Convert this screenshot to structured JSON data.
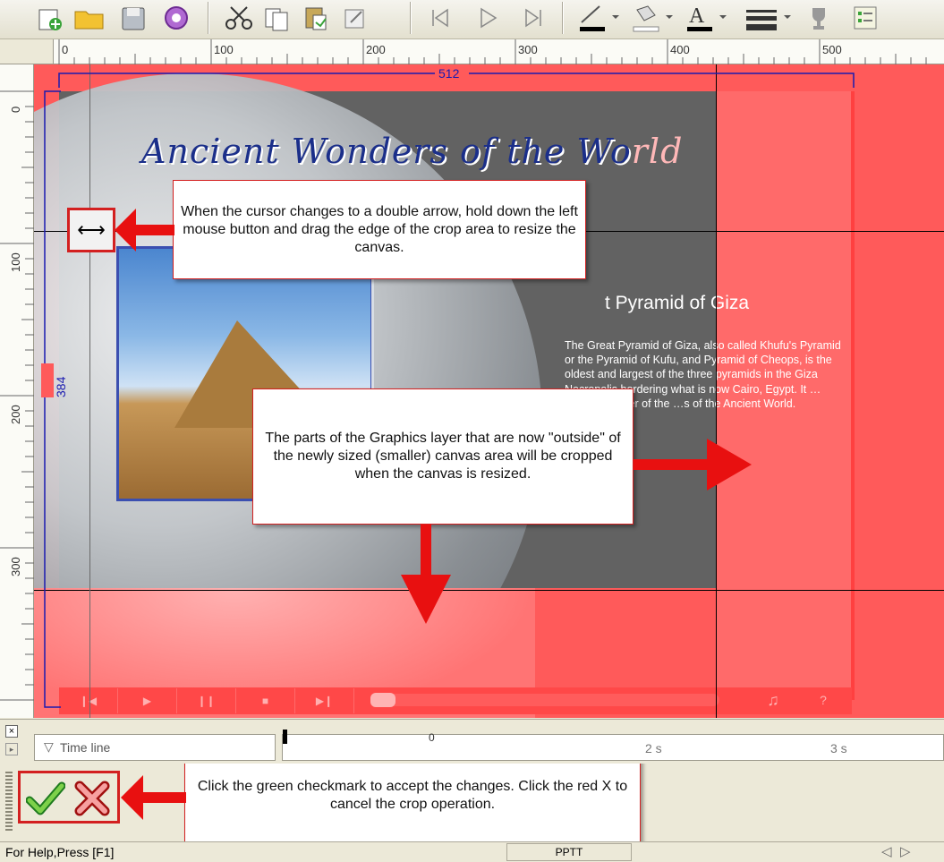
{
  "ruler": {
    "h_labels": [
      "0",
      "100",
      "200",
      "300",
      "400",
      "500"
    ],
    "v_labels": [
      "0",
      "100",
      "200",
      "300"
    ]
  },
  "dimensions": {
    "width": "512",
    "height": "384"
  },
  "slide": {
    "title_main": "Ancient Wonders of the Wo",
    "title_faded": "rld",
    "heading": "t Pyramid of Giza",
    "body": "The Great Pyramid of Giza, also called Khufu's Pyramid or the Pyramid of Kufu, and Pyramid of Cheops, is the oldest and largest of the three pyramids in the Giza Necropolis bordering what is now Cairo, Egypt. It …aining member of the …s of the Ancient World."
  },
  "callouts": {
    "resize": "When the cursor changes to a double arrow, hold down the left mouse button and drag the edge of the crop area to resize the canvas.",
    "outside": "The parts of the Graphics layer that are now \"outside\" of the newly sized (smaller) canvas area will be cropped when the canvas is resized.",
    "accept": "Click the green checkmark to accept the changes. Click the red X to cancel the crop operation."
  },
  "timeline": {
    "label": "Time line",
    "ticks": [
      "0",
      "2 s",
      "3 s"
    ]
  },
  "status": {
    "help": "For Help,Press [F1]",
    "pane": "PPTT"
  },
  "colors": {
    "accent_red": "#d32020",
    "crop_overlay": "#ff5a5a",
    "dim_blue": "#1a1ab0"
  },
  "icons": [
    "new-icon",
    "open-folder-icon",
    "save-icon",
    "record-icon",
    "cut-icon",
    "copy-icon",
    "paste-icon",
    "undo-icon",
    "first-frame-icon",
    "play-icon",
    "last-frame-icon",
    "line-color-icon",
    "fill-color-icon",
    "text-color-icon",
    "line-style-icon",
    "trophy-icon",
    "properties-icon"
  ]
}
